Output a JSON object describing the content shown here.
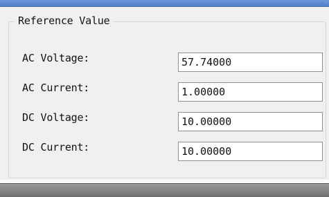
{
  "window": {
    "corner_glyph": "◦"
  },
  "reference_group": {
    "title": "Reference Value",
    "fields": [
      {
        "label": "AC Voltage:",
        "value": "57.74000"
      },
      {
        "label": "AC Current:",
        "value": "1.00000"
      },
      {
        "label": "DC Voltage:",
        "value": "10.00000"
      },
      {
        "label": "DC Current:",
        "value": "10.00000"
      }
    ]
  },
  "colors": {
    "window_background": "#f0f0f0",
    "top_strip": "#4f7ec7",
    "input_border": "#8f8f8f"
  }
}
